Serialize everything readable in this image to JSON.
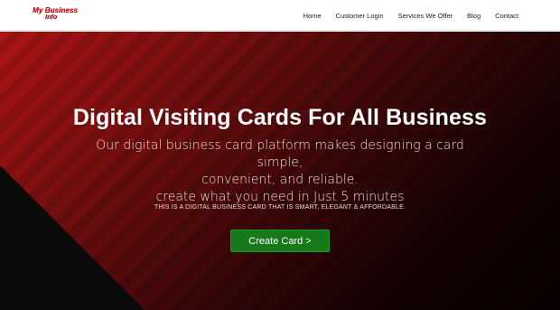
{
  "header": {
    "logo": {
      "line1": "My Business",
      "line2": "Info",
      "color": "#c4141a"
    },
    "nav": [
      {
        "label": "Home"
      },
      {
        "label": "Customer Login"
      },
      {
        "label": "Services We Offer"
      },
      {
        "label": "Blog"
      },
      {
        "label": "Contact"
      }
    ]
  },
  "hero": {
    "title": "Digital Visiting Cards For All Business",
    "subtitle_lines": [
      "Our digital business card platform makes designing a card simple,",
      "convenient, and reliable.",
      "create what you need in Just 5 minutes"
    ],
    "tagline": "THIS IS A DIGITAL BUSINESS CARD THAT IS SMART, ELEGANT & AFFORDABLE.",
    "cta_label": "Create Card >",
    "colors": {
      "accent_red": "#b01414",
      "cta_green": "#167a1b"
    }
  }
}
